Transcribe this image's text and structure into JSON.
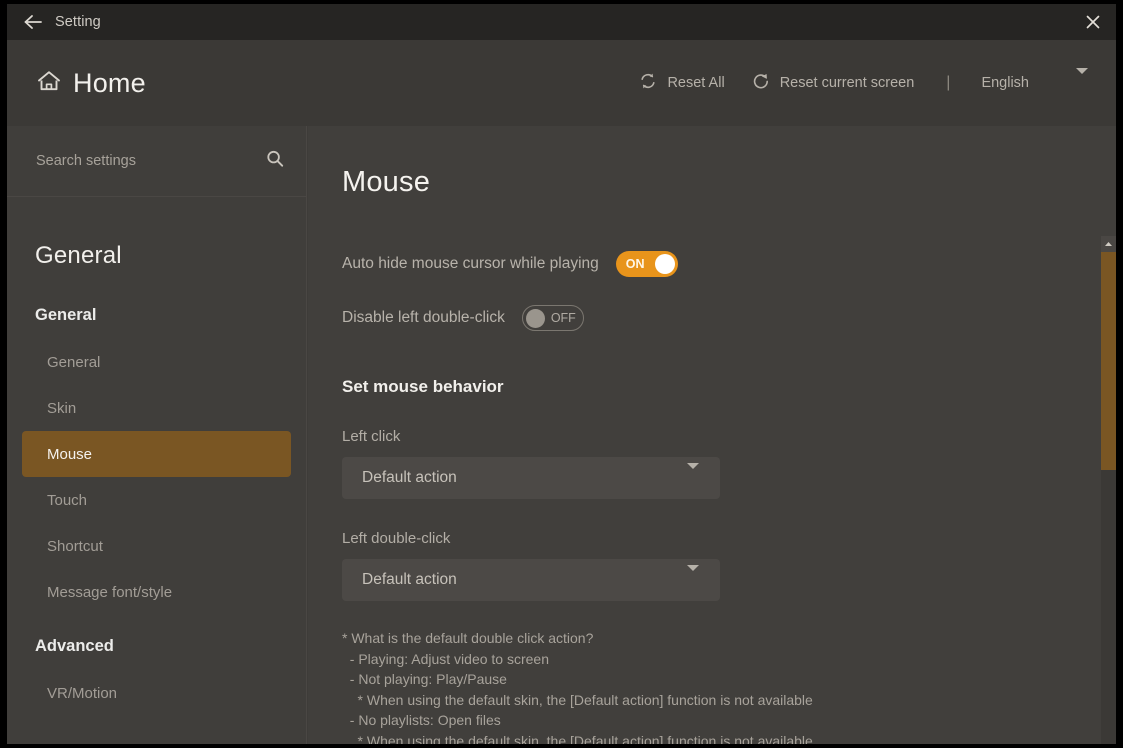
{
  "titlebar": {
    "back_icon": "back-arrow-icon",
    "title": "Setting",
    "close_icon": "close-icon"
  },
  "header": {
    "home_icon": "home-icon",
    "home_label": "Home",
    "reset_all_icon": "refresh-cycle-icon",
    "reset_all_label": "Reset All",
    "reset_screen_icon": "refresh-single-icon",
    "reset_screen_label": "Reset current screen",
    "separator": "|",
    "language_value": "English",
    "language_caret_icon": "chevron-down-icon"
  },
  "sidebar": {
    "search_placeholder": "Search settings",
    "search_value": "",
    "search_icon": "search-icon",
    "title": "General",
    "groups": [
      {
        "label": "General",
        "items": [
          {
            "label": "General",
            "active": false
          },
          {
            "label": "Skin",
            "active": false
          },
          {
            "label": "Mouse",
            "active": true
          },
          {
            "label": "Touch",
            "active": false
          },
          {
            "label": "Shortcut",
            "active": false
          },
          {
            "label": "Message font/style",
            "active": false
          }
        ]
      },
      {
        "label": "Advanced",
        "items": [
          {
            "label": "VR/Motion",
            "active": false
          }
        ]
      }
    ]
  },
  "main": {
    "page_title": "Mouse",
    "toggles": [
      {
        "label": "Auto hide mouse cursor while playing",
        "state": "ON"
      },
      {
        "label": "Disable left double-click",
        "state": "OFF"
      }
    ],
    "section_heading": "Set mouse behavior",
    "fields": [
      {
        "label": "Left click",
        "value": "Default action"
      },
      {
        "label": "Left double-click",
        "value": "Default action"
      }
    ],
    "note": "* What is the default double click action?\n  - Playing: Adjust video to screen\n  - Not playing: Play/Pause\n    * When using the default skin, the [Default action] function is not available\n  - No playlists: Open files\n    * When using the default skin, the [Default action] function is not available"
  },
  "scrollbar": {
    "up_arrow_icon": "scroll-up-arrow-icon",
    "thumb": "scroll-thumb"
  },
  "colors": {
    "accent": "#7a5623",
    "toggle_on": "#e8941b",
    "window_bg": "#3e3c39",
    "titlebar_bg": "#262523",
    "sidebar_bg": "#403e3b",
    "main_bg": "#413f3c"
  }
}
